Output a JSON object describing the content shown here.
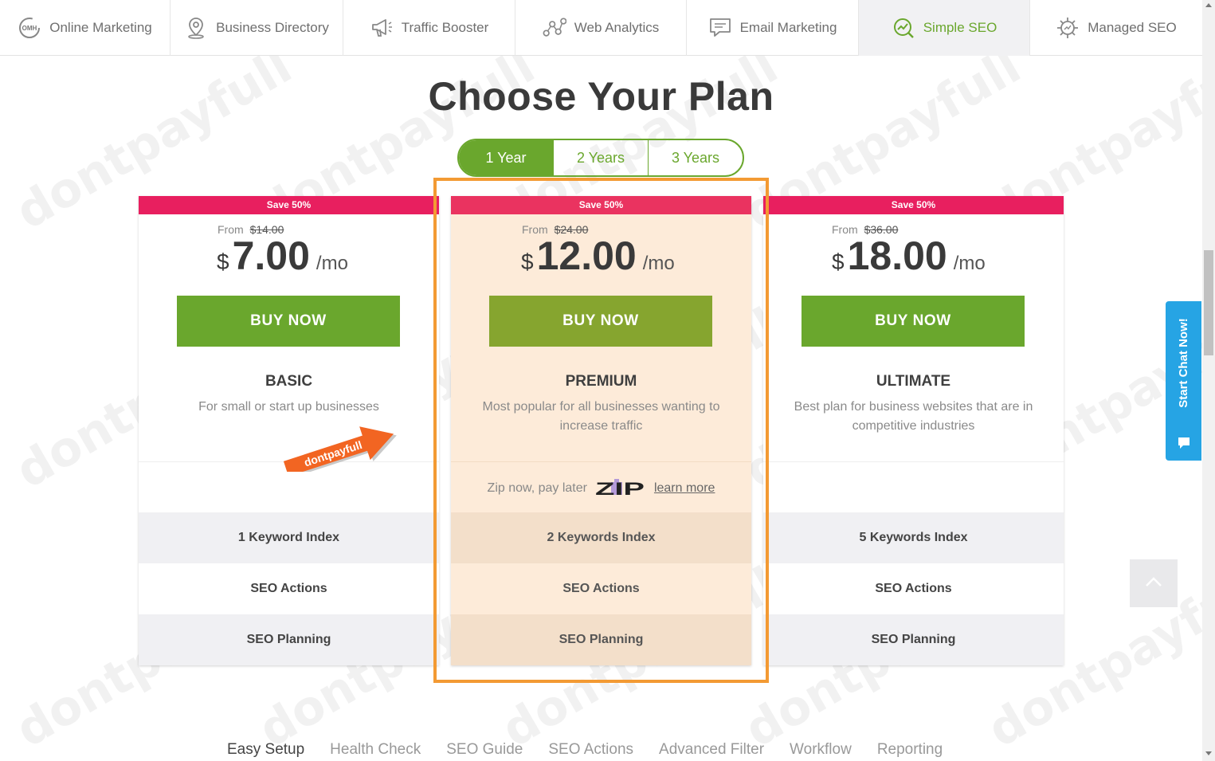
{
  "nav": {
    "items": [
      {
        "label": "Online Marketing",
        "icon": "omh-logo-icon",
        "active": false
      },
      {
        "label": "Business Directory",
        "icon": "map-pin-icon",
        "active": false
      },
      {
        "label": "Traffic Booster",
        "icon": "megaphone-icon",
        "active": false
      },
      {
        "label": "Web Analytics",
        "icon": "analytics-nodes-icon",
        "active": false
      },
      {
        "label": "Email Marketing",
        "icon": "email-chat-icon",
        "active": false
      },
      {
        "label": "Simple SEO",
        "icon": "seo-chart-icon",
        "active": true
      },
      {
        "label": "Managed SEO",
        "icon": "managed-gear-icon",
        "active": false
      }
    ],
    "omh_text": "OMH"
  },
  "page_title": "Choose Your Plan",
  "period_tabs": {
    "items": [
      "1 Year",
      "2 Years",
      "3 Years"
    ],
    "selected": "1 Year"
  },
  "plans": [
    {
      "save": "Save 50%",
      "from": "From",
      "old_price": "$14.00",
      "currency": "$",
      "price": "7.00",
      "per": "/mo",
      "buy": "BUY NOW",
      "name": "BASIC",
      "desc": "For small or start up businesses",
      "features": [
        "1 Keyword Index",
        "SEO Actions",
        "SEO Planning"
      ]
    },
    {
      "save": "Save 50%",
      "from": "From",
      "old_price": "$24.00",
      "currency": "$",
      "price": "12.00",
      "per": "/mo",
      "buy": "BUY NOW",
      "name": "PREMIUM",
      "desc": "Most popular for all businesses wanting to increase traffic",
      "features": [
        "2 Keywords Index",
        "SEO Actions",
        "SEO Planning"
      ],
      "zip_text": "Zip now, pay later",
      "zip_logo": "ZIP",
      "zip_link": "learn more"
    },
    {
      "save": "Save 50%",
      "from": "From",
      "old_price": "$36.00",
      "currency": "$",
      "price": "18.00",
      "per": "/mo",
      "buy": "BUY NOW",
      "name": "ULTIMATE",
      "desc": "Best plan for business websites that are in competitive industries",
      "features": [
        "5 Keywords Index",
        "SEO Actions",
        "SEO Planning"
      ]
    }
  ],
  "promo_arrow_text": "dontpayfull",
  "watermark_text": "dontpayfull",
  "bottom_tabs": {
    "items": [
      "Easy Setup",
      "Health Check",
      "SEO Guide",
      "SEO Actions",
      "Advanced Filter",
      "Workflow",
      "Reporting"
    ],
    "selected": "Easy Setup"
  },
  "chat": {
    "label": "Start Chat Now!"
  },
  "colors": {
    "brand_green": "#6aa72d",
    "save_pink": "#e81f5f",
    "highlight_orange": "#f39a33",
    "chat_blue": "#26a4e4"
  }
}
